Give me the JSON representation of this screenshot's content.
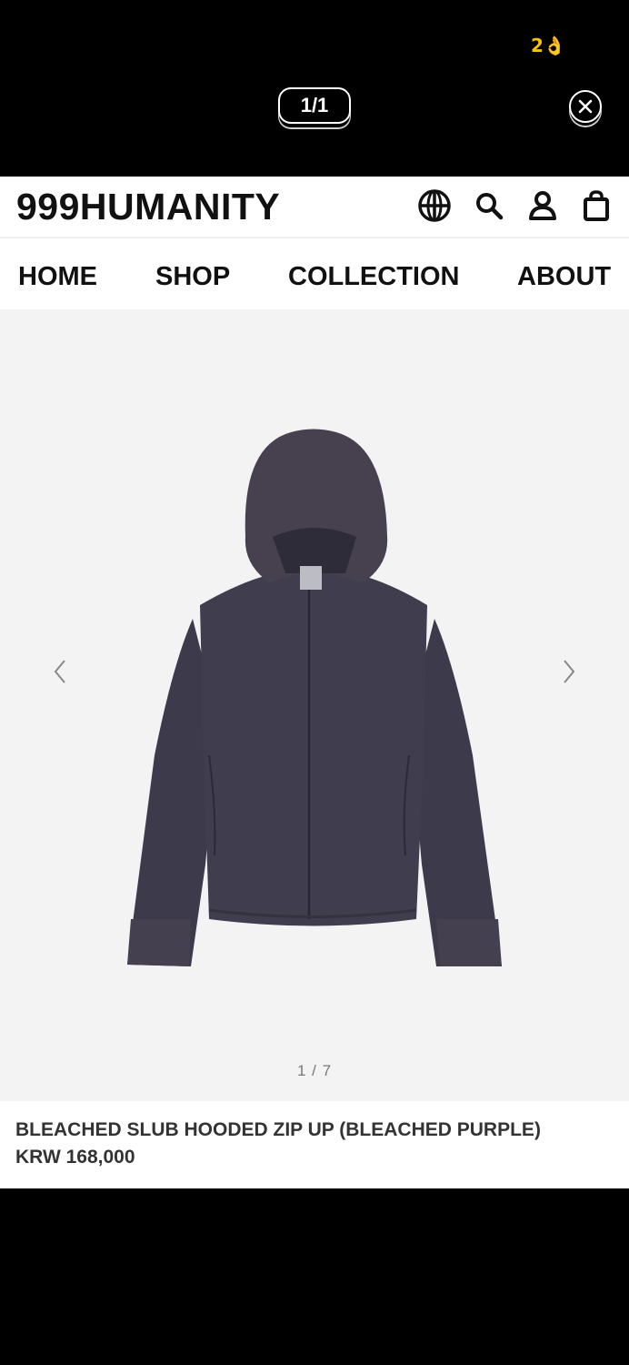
{
  "viewer": {
    "status_emoji": "2👌",
    "counter": "1/1",
    "close_icon": "close-circle-icon"
  },
  "site": {
    "logo": "999HUMANITY",
    "header_icons": [
      "globe-icon",
      "search-icon",
      "user-icon",
      "shopping-bag-icon"
    ],
    "nav": {
      "home": "HOME",
      "shop": "SHOP",
      "collection": "COLLECTION",
      "about": "ABOUT"
    },
    "gallery": {
      "counter": "1 / 7",
      "image": "bleached purple hooded zip-up"
    },
    "product": {
      "title": "BLEACHED SLUB HOODED ZIP UP (BLEACHED PURPLE)",
      "price": "KRW 168,000"
    }
  },
  "colors": {
    "viewer_bg": "#000000",
    "page_bg": "#ffffff",
    "gallery_bg": "#f3f3f4",
    "text": "#111111",
    "hoodie": "#3f3d4d"
  }
}
